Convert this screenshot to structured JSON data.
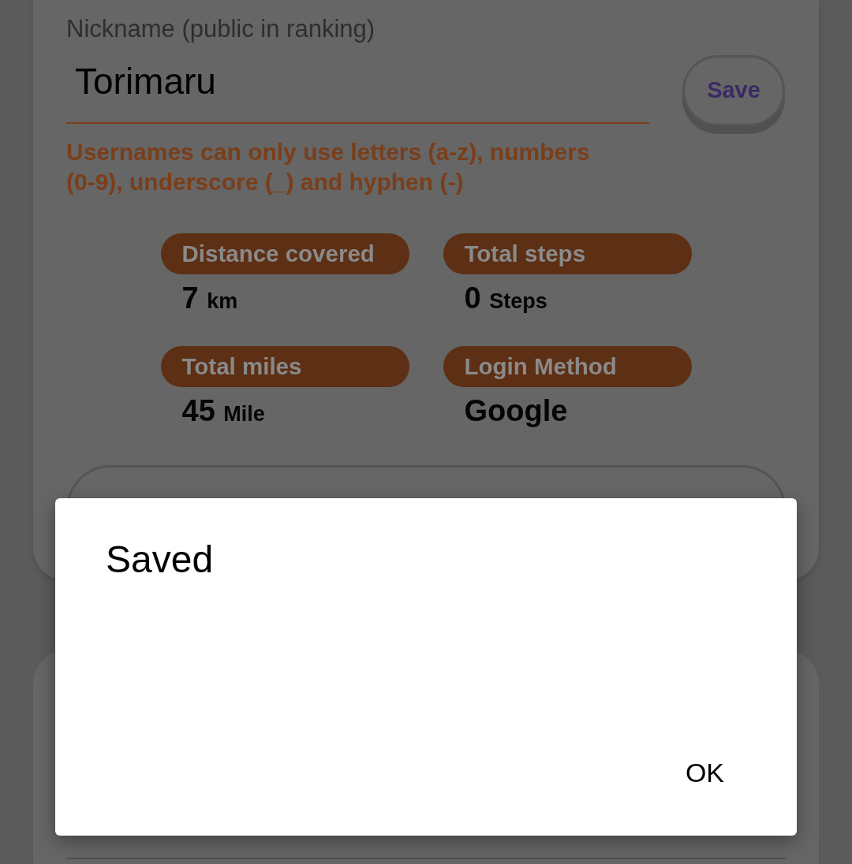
{
  "profile_card": {
    "nickname_field": {
      "label": "Nickname (public in ranking)",
      "value": "Torimaru",
      "error": "Usernames can only use letters (a-z), numbers (0-9), underscore (_) and hyphen (-)"
    },
    "save_button": {
      "label": "Save"
    },
    "stats": [
      {
        "label": "Distance covered",
        "value": "7",
        "unit": "km"
      },
      {
        "label": "Total steps",
        "value": "0",
        "unit": "Steps"
      },
      {
        "label": "Total miles",
        "value": "45",
        "unit": "Mile"
      },
      {
        "label": "Login Method",
        "value": "Google"
      }
    ]
  },
  "dialog": {
    "title": "Saved",
    "buttons": [
      "OK"
    ]
  }
}
